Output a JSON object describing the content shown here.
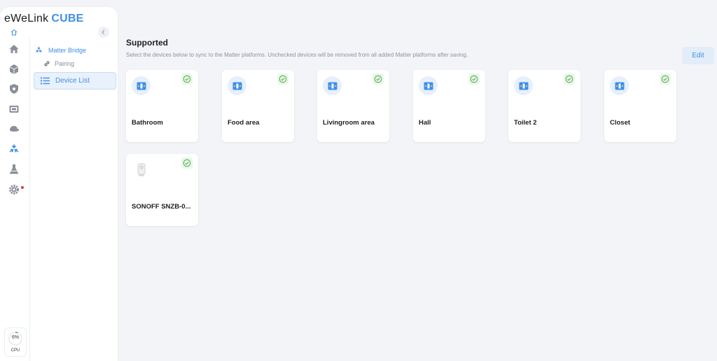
{
  "brand": {
    "name": "eWeLink",
    "product": "CUBE"
  },
  "sidebar": {
    "rail_icons": [
      {
        "name": "home-icon"
      },
      {
        "name": "cube-icon"
      },
      {
        "name": "shield-icon"
      },
      {
        "name": "camera-icon"
      },
      {
        "name": "hat-icon"
      },
      {
        "name": "matter-icon"
      },
      {
        "name": "flask-icon"
      },
      {
        "name": "gear-icon"
      }
    ],
    "cpu": {
      "value": "6%",
      "label": "CPU",
      "fraction": 0.06
    },
    "nav": {
      "section": "Matter Bridge",
      "pairing": "Pairing",
      "device_list": "Device List"
    }
  },
  "main": {
    "title": "Supported",
    "description": "Select the devices below to sync to the Matter platforms. Unchecked devices will be removed from all added Matter platforms after saving.",
    "edit_label": "Edit",
    "devices": [
      {
        "name": "Bathroom",
        "icon": "switch-icon",
        "checked": true
      },
      {
        "name": "Food area",
        "icon": "switch-icon",
        "checked": true
      },
      {
        "name": "Livingroom area",
        "icon": "switch-icon",
        "checked": true
      },
      {
        "name": "Hall",
        "icon": "switch-icon",
        "checked": true
      },
      {
        "name": "Toilet 2",
        "icon": "switch-icon",
        "checked": true
      },
      {
        "name": "Closet",
        "icon": "switch-icon",
        "checked": true
      },
      {
        "name": "SONOFF SNZB-0...",
        "icon": "sensor-icon",
        "checked": true
      }
    ]
  },
  "colors": {
    "accent": "#3f8fe3",
    "check": "#4caf50",
    "background": "#f3f4f8"
  }
}
